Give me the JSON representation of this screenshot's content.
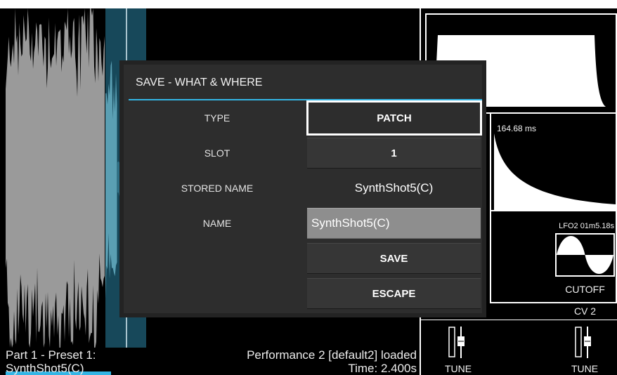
{
  "screen": {
    "status": {
      "part_label": "Part 1 - Preset 1:",
      "preset_name": "SynthShot5(C)",
      "performance_message": "Performance 2 [default2] loaded",
      "time_readout": "Time: 2.400s"
    },
    "panels": {
      "envelope_time": "164.68 ms",
      "lfo_label": "LFO2 01m5.18s",
      "lfo_icon": "sine-wave-icon",
      "lfo_target": "CUTOFF",
      "cv_label": "CV 2",
      "controls": [
        {
          "label": "TUNE",
          "icon": "slider-icon"
        },
        {
          "label": "TUNE",
          "icon": "slider-icon"
        }
      ]
    }
  },
  "dialog": {
    "title": "SAVE - WHAT & WHERE",
    "type": {
      "label": "TYPE",
      "value": "PATCH",
      "focused": true
    },
    "slot": {
      "label": "SLOT",
      "value": "1"
    },
    "stored_name": {
      "label": "STORED NAME",
      "value": "SynthShot5(C)"
    },
    "name": {
      "label": "NAME",
      "value": "SynthShot5(C)"
    },
    "save_label": "SAVE",
    "escape_label": "ESCAPE"
  },
  "colors": {
    "accent": "#33b5e5",
    "dialog_background": "#2d2d2d",
    "button_background": "#363636",
    "input_background": "#8e8e8e",
    "waveform": "#9a9a9a",
    "selection": "#17485a",
    "selection_trace": "#5a9fb3",
    "selection_tail": "#2f6f85",
    "playhead": "#d8eef5",
    "text": "#f0f0f0"
  }
}
